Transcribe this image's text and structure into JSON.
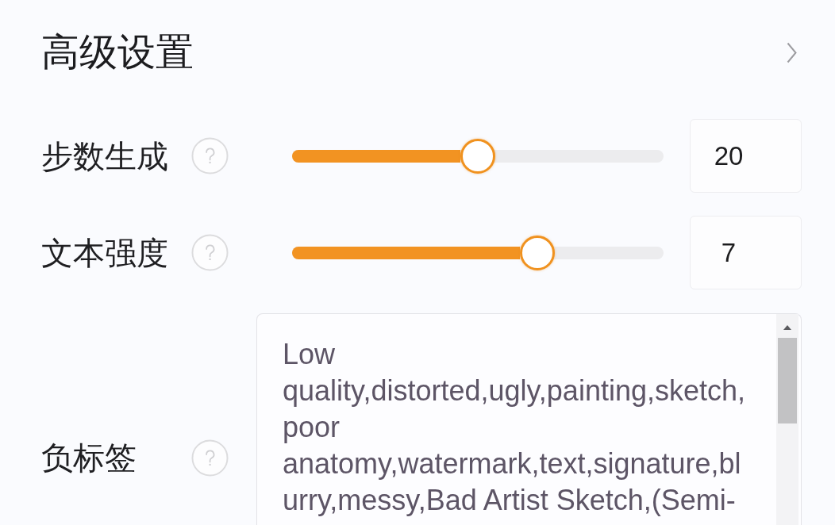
{
  "section": {
    "title": "高级设置"
  },
  "sliders": [
    {
      "label": "步数生成",
      "level": 0.5,
      "value": "20"
    },
    {
      "label": "文本强度",
      "level": 0.66,
      "value": "7"
    }
  ],
  "negative_prompt": {
    "label": "负标签",
    "value": "Low quality,distorted,ugly,painting,sketch,poor anatomy,watermark,text,signature,blurry,messy,Bad Artist Sketch,(Semi-"
  }
}
